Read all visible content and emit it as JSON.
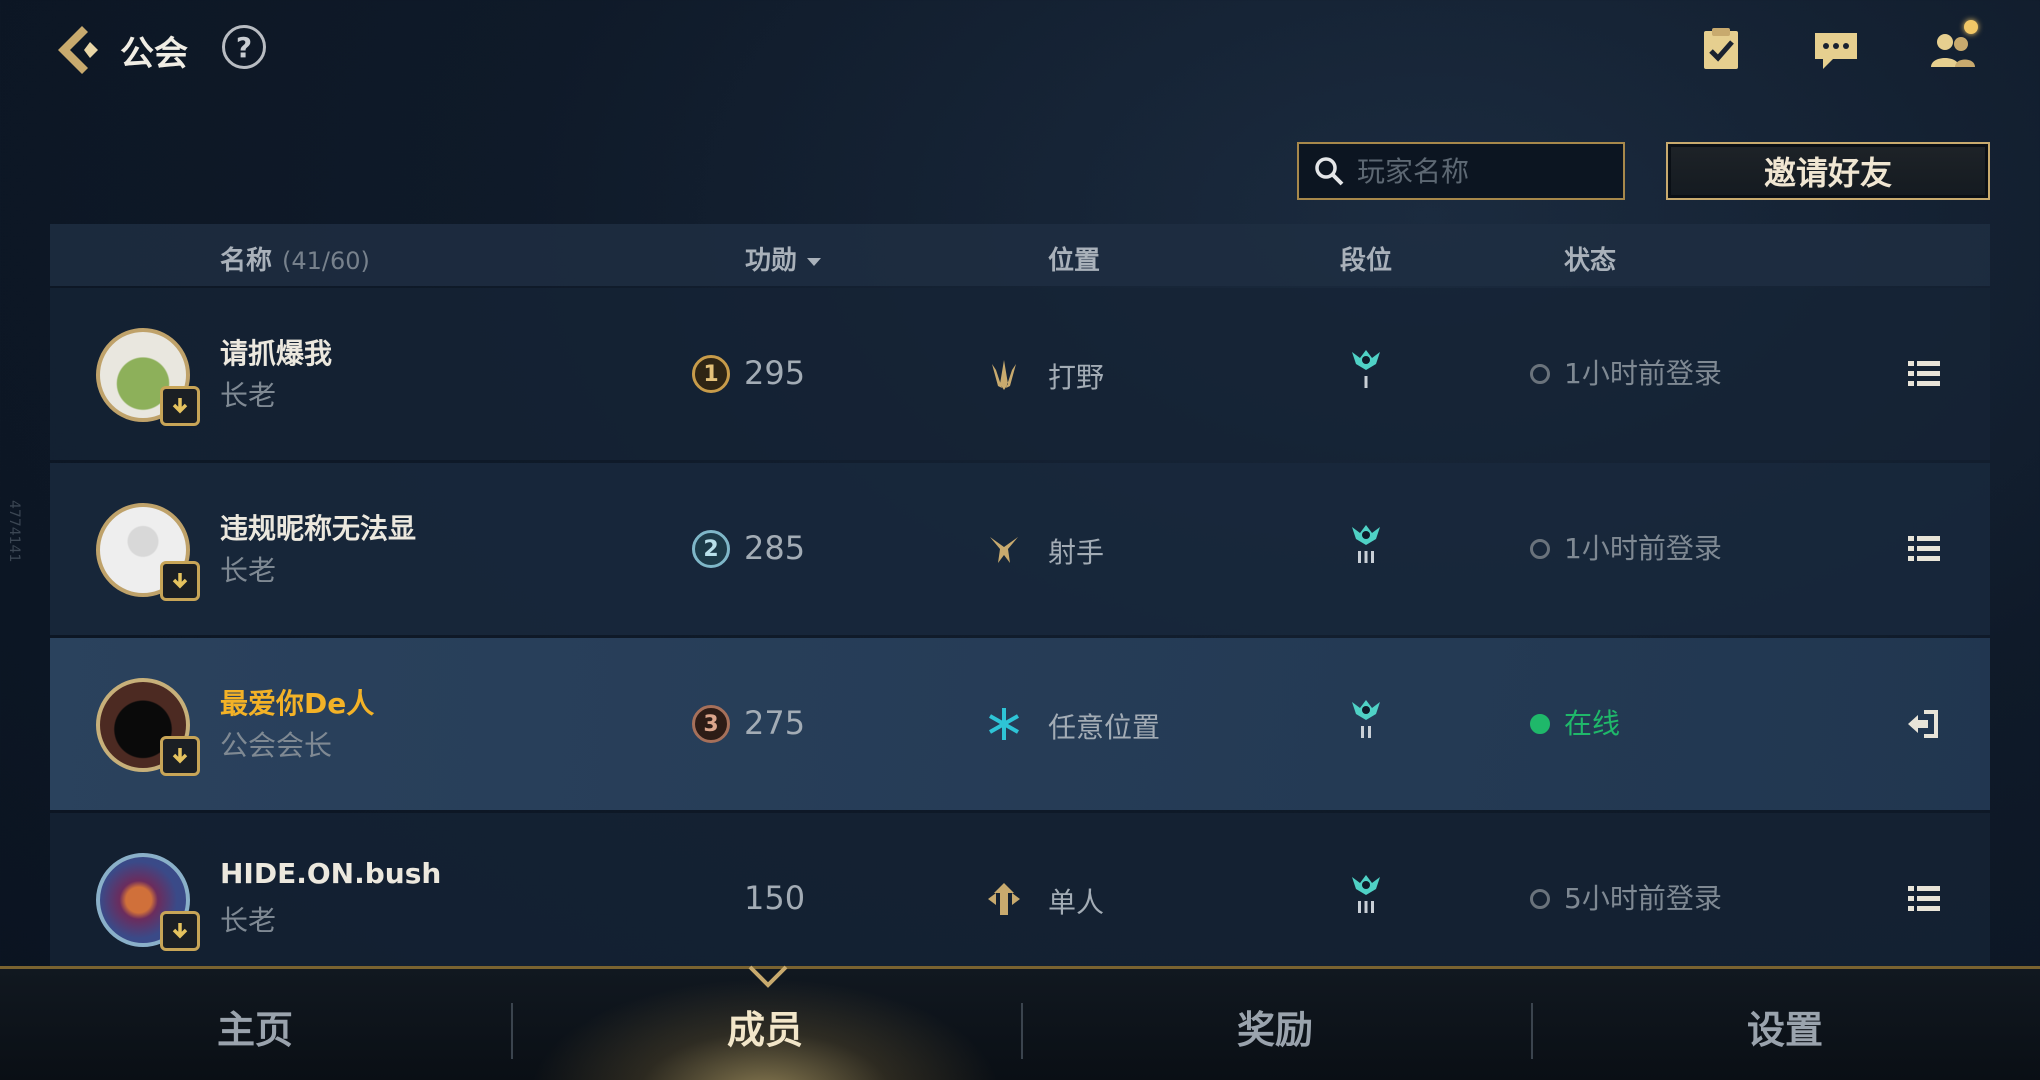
{
  "header": {
    "title": "公会",
    "help_label": "?"
  },
  "toolbar": {
    "search_placeholder": "玩家名称",
    "invite_label": "邀请好友"
  },
  "table": {
    "columns": {
      "name": "名称",
      "count": "(41/60)",
      "merit": "功勋",
      "position": "位置",
      "tier": "段位",
      "status": "状态"
    },
    "rows": [
      {
        "name": "请抓爆我",
        "role": "长老",
        "merit_rank": "1",
        "merit": "295",
        "position": "打野",
        "position_icon": "jungle-icon",
        "tier_numeral": "I",
        "status": "1小时前登录",
        "online": false,
        "action_icon": "menu-icon"
      },
      {
        "name": "违规昵称无法显",
        "role": "长老",
        "merit_rank": "2",
        "merit": "285",
        "position": "射手",
        "position_icon": "marksman-icon",
        "tier_numeral": "III",
        "status": "1小时前登录",
        "online": false,
        "action_icon": "menu-icon"
      },
      {
        "name": "最爱你De人",
        "role": "公会会长",
        "merit_rank": "3",
        "merit": "275",
        "position": "任意位置",
        "position_icon": "any-position-icon",
        "tier_numeral": "II",
        "status": "在线",
        "online": true,
        "action_icon": "exit-icon"
      },
      {
        "name": "HIDE.ON.bush",
        "role": "长老",
        "merit_rank": "",
        "merit": "150",
        "position": "单人",
        "position_icon": "solo-icon",
        "tier_numeral": "III",
        "status": "5小时前登录",
        "online": false,
        "action_icon": "menu-icon"
      }
    ]
  },
  "watermark": "4774141",
  "bottom_nav": {
    "items": [
      {
        "label": "主页"
      },
      {
        "label": "成员"
      },
      {
        "label": "奖励"
      },
      {
        "label": "设置"
      }
    ],
    "active_index": 1
  },
  "colors": {
    "gold_accent": "#c8aa6e",
    "online_green": "#1fb86a",
    "leader_name": "#f3b227",
    "teal_icon": "#4fd1c5"
  }
}
